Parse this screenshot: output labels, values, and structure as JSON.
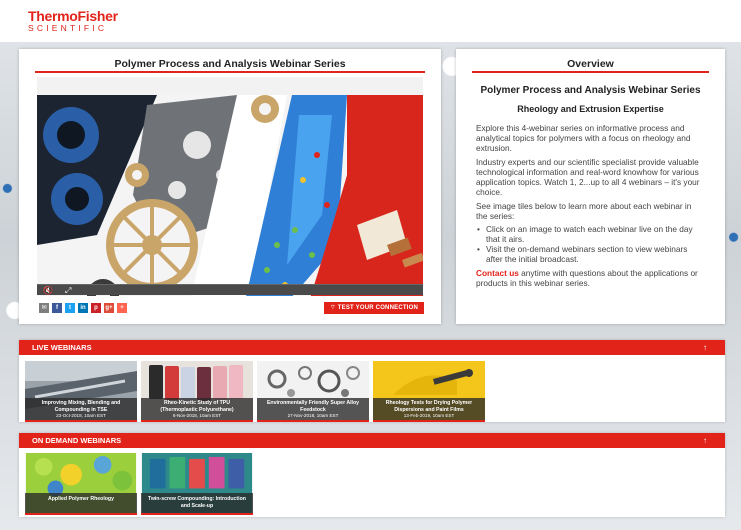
{
  "header": {
    "logo_line1": "ThermoFisher",
    "logo_line2": "SCIENTIFIC"
  },
  "video_panel": {
    "title": "Polymer Process and Analysis Webinar Series",
    "share_buttons": [
      {
        "icon": "email-icon",
        "glyph": "✉",
        "color": "#7f7f7f"
      },
      {
        "icon": "facebook-icon",
        "glyph": "f",
        "color": "#3b5998"
      },
      {
        "icon": "twitter-icon",
        "glyph": "t",
        "color": "#1da1f2"
      },
      {
        "icon": "linkedin-icon",
        "glyph": "in",
        "color": "#0077b5"
      },
      {
        "icon": "pinterest-icon",
        "glyph": "p",
        "color": "#cb2027"
      },
      {
        "icon": "googleplus-icon",
        "glyph": "g+",
        "color": "#dd4b39"
      },
      {
        "icon": "more-share-icon",
        "glyph": "+",
        "color": "#ff6550"
      }
    ],
    "test_connection_label": "TEST YOUR CONNECTION"
  },
  "overview": {
    "title": "Overview",
    "heading": "Polymer Process and Analysis Webinar Series",
    "subheading": "Rheology and Extrusion Expertise",
    "para1": "Explore this 4-webinar series on informative process and analytical topics for polymers with a focus on rheology and extrusion.",
    "para2": "Industry experts and our scientific specialist provide valuable technological information and real-word knowhow for various application topics. Watch 1, 2...up to all 4 webinars – it's your choice.",
    "para3": "See image tiles below to learn more about each webinar in the series:",
    "bullets": [
      "Click on an image to watch each webinar live on the day that it airs.",
      "Visit the on-demand webinars section to view webinars after the initial broadcast."
    ],
    "contact_link": "Contact us",
    "contact_rest": " anytime with questions about the applications or products in this webinar series."
  },
  "live_webinars": {
    "label": "LIVE WEBINARS",
    "tiles": [
      {
        "title": "Improving Mixing, Blending and Compounding in TSE",
        "date": "23-Oct-2018, 10am EST"
      },
      {
        "title": "Rheo-Kinetic Study of TPU (Thermoplastic Polyurethane)",
        "date": "6-Nov-2018, 10am EST"
      },
      {
        "title": "Environmentally Friendly Super Alloy Feedstock",
        "date": "27-Nov-2018, 10am EST"
      },
      {
        "title": "Rheology Tests for Drying Polymer Dispersions and Paint Films",
        "date": "13-Feb-2019, 10am EST"
      }
    ]
  },
  "on_demand_webinars": {
    "label": "ON DEMAND WEBINARS",
    "tiles": [
      {
        "title": "Applied Polymer Rheology"
      },
      {
        "title": "Twin-screw Compounding: Introduction and Scale-up"
      }
    ]
  },
  "colors": {
    "brand_red": "#e2231a"
  }
}
